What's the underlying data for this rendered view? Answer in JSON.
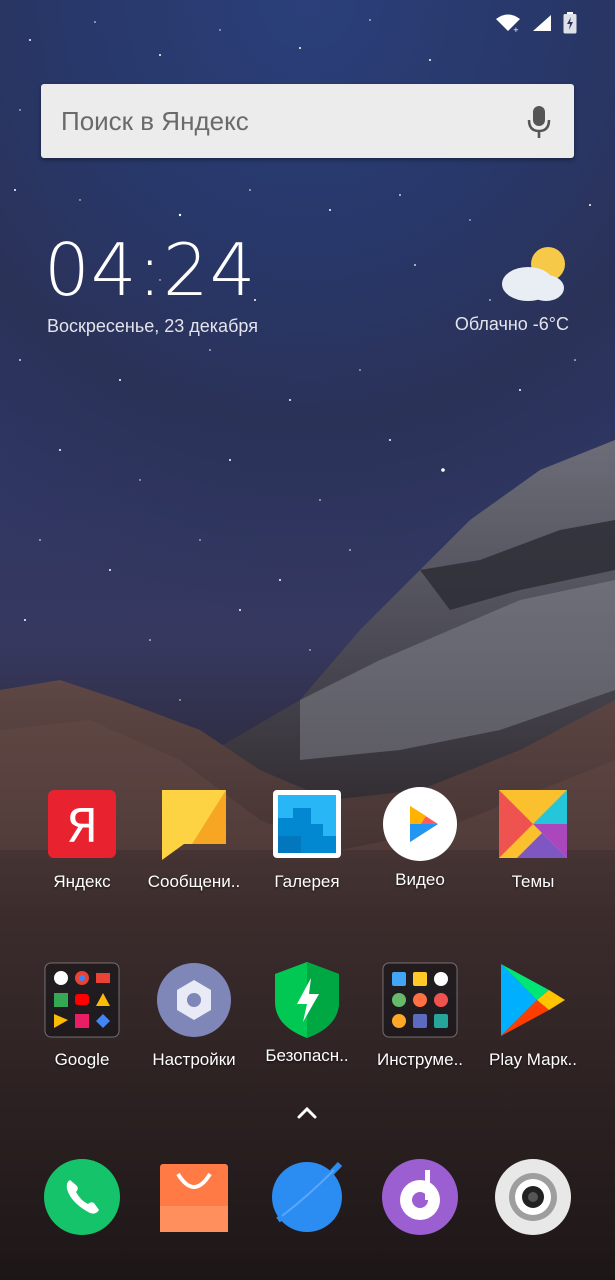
{
  "search": {
    "placeholder": "Поиск в Яндекс"
  },
  "clock": {
    "time": "04:24",
    "date": "Воскресенье, 23 декабря"
  },
  "weather": {
    "text": "Облачно  -6°C",
    "icon": "partly-cloudy-icon"
  },
  "apps_row1": [
    {
      "label": "Яндекс",
      "icon": "yandex-icon"
    },
    {
      "label": "Сообщени..",
      "icon": "messages-icon"
    },
    {
      "label": "Галерея",
      "icon": "gallery-icon"
    },
    {
      "label": "Видео",
      "icon": "video-icon"
    },
    {
      "label": "Темы",
      "icon": "themes-icon"
    }
  ],
  "apps_row2": [
    {
      "label": "Google",
      "icon": "google-folder-icon"
    },
    {
      "label": "Настройки",
      "icon": "settings-icon"
    },
    {
      "label": "Безопасн..",
      "icon": "security-icon"
    },
    {
      "label": "Инструме..",
      "icon": "tools-folder-icon"
    },
    {
      "label": "Play Марк..",
      "icon": "play-store-icon"
    }
  ],
  "dock": [
    {
      "icon": "phone-icon"
    },
    {
      "icon": "mi-store-icon"
    },
    {
      "icon": "browser-icon"
    },
    {
      "icon": "music-icon"
    },
    {
      "icon": "camera-icon"
    }
  ]
}
